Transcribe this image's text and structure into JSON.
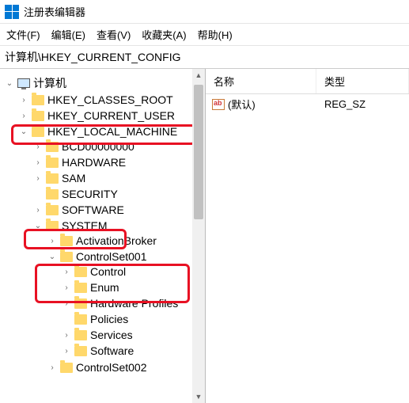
{
  "title": "注册表编辑器",
  "menu": {
    "file": "文件(F)",
    "edit": "编辑(E)",
    "view": "查看(V)",
    "favorites": "收藏夹(A)",
    "help": "帮助(H)"
  },
  "address": "计算机\\HKEY_CURRENT_CONFIG",
  "tree": {
    "root": "计算机",
    "hkcr": "HKEY_CLASSES_ROOT",
    "hkcu": "HKEY_CURRENT_USER",
    "hklm": "HKEY_LOCAL_MACHINE",
    "hklm_children": {
      "bcd": "BCD00000000",
      "hardware": "HARDWARE",
      "sam": "SAM",
      "security": "SECURITY",
      "software": "SOFTWARE",
      "system": "SYSTEM",
      "system_children": {
        "activation": "ActivationBroker",
        "cs001": "ControlSet001",
        "cs001_children": {
          "control": "Control",
          "enum": "Enum",
          "hwprofile": "Hardware Profiles",
          "policies": "Policies",
          "services": "Services",
          "cs_software": "Software"
        },
        "cs002": "ControlSet002"
      }
    }
  },
  "list": {
    "header_name": "名称",
    "header_type": "类型",
    "row0_name": "(默认)",
    "row0_type": "REG_SZ"
  }
}
